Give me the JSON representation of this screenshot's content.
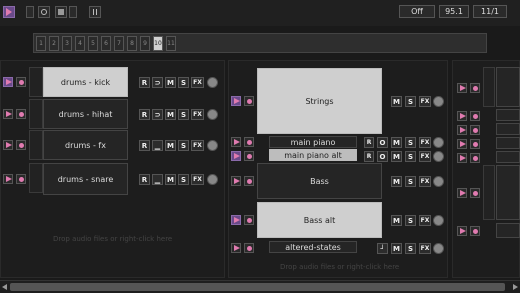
{
  "transport": {
    "play_icon": "play-icon",
    "off_label": "Off",
    "tempo": "95.1",
    "signature": "11/1"
  },
  "sequencer": {
    "steps": [
      "1",
      "2",
      "3",
      "4",
      "5",
      "6",
      "7",
      "8",
      "9",
      "10",
      "11"
    ],
    "active_step": "10"
  },
  "columns": {
    "left": {
      "tracks": [
        {
          "name": "drums - kick",
          "selected": true,
          "playing": true
        },
        {
          "name": "drums - hihat",
          "selected": false,
          "playing": false
        },
        {
          "name": "drums - fx",
          "selected": false,
          "playing": false
        },
        {
          "name": "drums - snare",
          "selected": false,
          "playing": false
        }
      ],
      "hint": "Drop audio files or right-click here"
    },
    "middle": {
      "tracks": [
        {
          "name": "Strings",
          "selected": true,
          "playing": true
        },
        {
          "name": "main piano",
          "selected": false,
          "playing": false
        },
        {
          "name": "main piano alt",
          "selected": false,
          "playing": true
        },
        {
          "name": "Bass",
          "selected": false,
          "playing": false
        },
        {
          "name": "Bass alt",
          "selected": true,
          "playing": true
        },
        {
          "name": "altered-states",
          "selected": false,
          "playing": false
        }
      ],
      "hint": "Drop audio files or right-click here"
    }
  },
  "buttons": {
    "r": "R",
    "m": "M",
    "s": "S",
    "fx": "FX",
    "o": "O"
  },
  "colors": {
    "accent": "#e07bb0",
    "active_bg": "#6a4a8a",
    "selected_clip": "#cfcfcf"
  }
}
